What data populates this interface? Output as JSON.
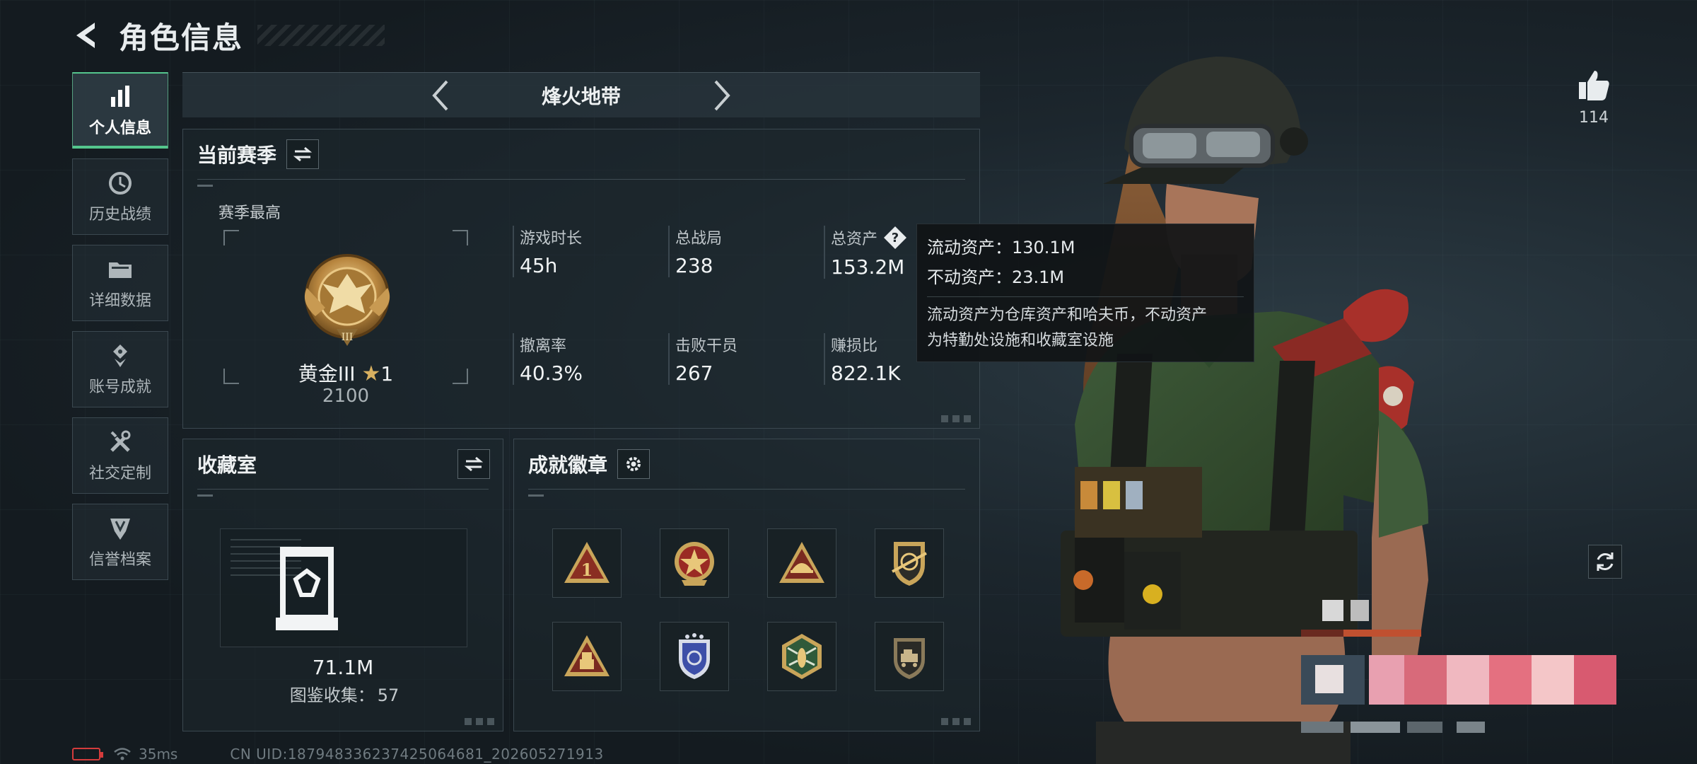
{
  "header": {
    "title": "角色信息"
  },
  "sidebar": {
    "items": [
      {
        "label": "个人信息",
        "icon": "bar-chart-icon",
        "active": true
      },
      {
        "label": "历史战绩",
        "icon": "history-clock-icon",
        "active": false
      },
      {
        "label": "详细数据",
        "icon": "folder-icon",
        "active": false
      },
      {
        "label": "账号成就",
        "icon": "achievement-icon",
        "active": false
      },
      {
        "label": "社交定制",
        "icon": "tools-icon",
        "active": false
      },
      {
        "label": "信誉档案",
        "icon": "shield-emblem-icon",
        "active": false
      }
    ]
  },
  "mode": {
    "title": "烽火地带"
  },
  "season": {
    "title": "当前赛季",
    "best_label": "赛季最高",
    "rank_name": "黄金III",
    "rank_star_count": "1",
    "rank_score": "2100",
    "stats": [
      {
        "label": "游戏时长",
        "value": "45h"
      },
      {
        "label": "总战局",
        "value": "238"
      },
      {
        "label": "总资产",
        "value": "153.2M"
      },
      {
        "label": "撤离率",
        "value": "40.3%"
      },
      {
        "label": "击败干员",
        "value": "267"
      },
      {
        "label": "赚损比",
        "value": "822.1K"
      }
    ]
  },
  "tooltip": {
    "liquid": "流动资产：130.1M",
    "fixed": "不动资产：23.1M",
    "desc_line1": "流动资产为仓库资产和哈夫币，不动资产",
    "desc_line2": "为特勤处设施和收藏室设施"
  },
  "collection": {
    "title": "收藏室",
    "value": "71.1M",
    "count_label": "图鉴收集：",
    "count_value": "57"
  },
  "badges": {
    "title": "成就徽章",
    "items": [
      "rank-1-badge",
      "red-star-badge",
      "helmet-badge",
      "target-crest-badge",
      "soldier-badge",
      "shield-wings-badge",
      "wasp-badge",
      "vehicle-badge"
    ]
  },
  "profile": {
    "likes": "114"
  },
  "status": {
    "ping": "35ms",
    "uid": "CN UID:18794833623742506468­1_202605271913"
  },
  "colors": {
    "accent": "#54c68d",
    "panel_border": "#3b4850",
    "gold": "#d8b060"
  }
}
